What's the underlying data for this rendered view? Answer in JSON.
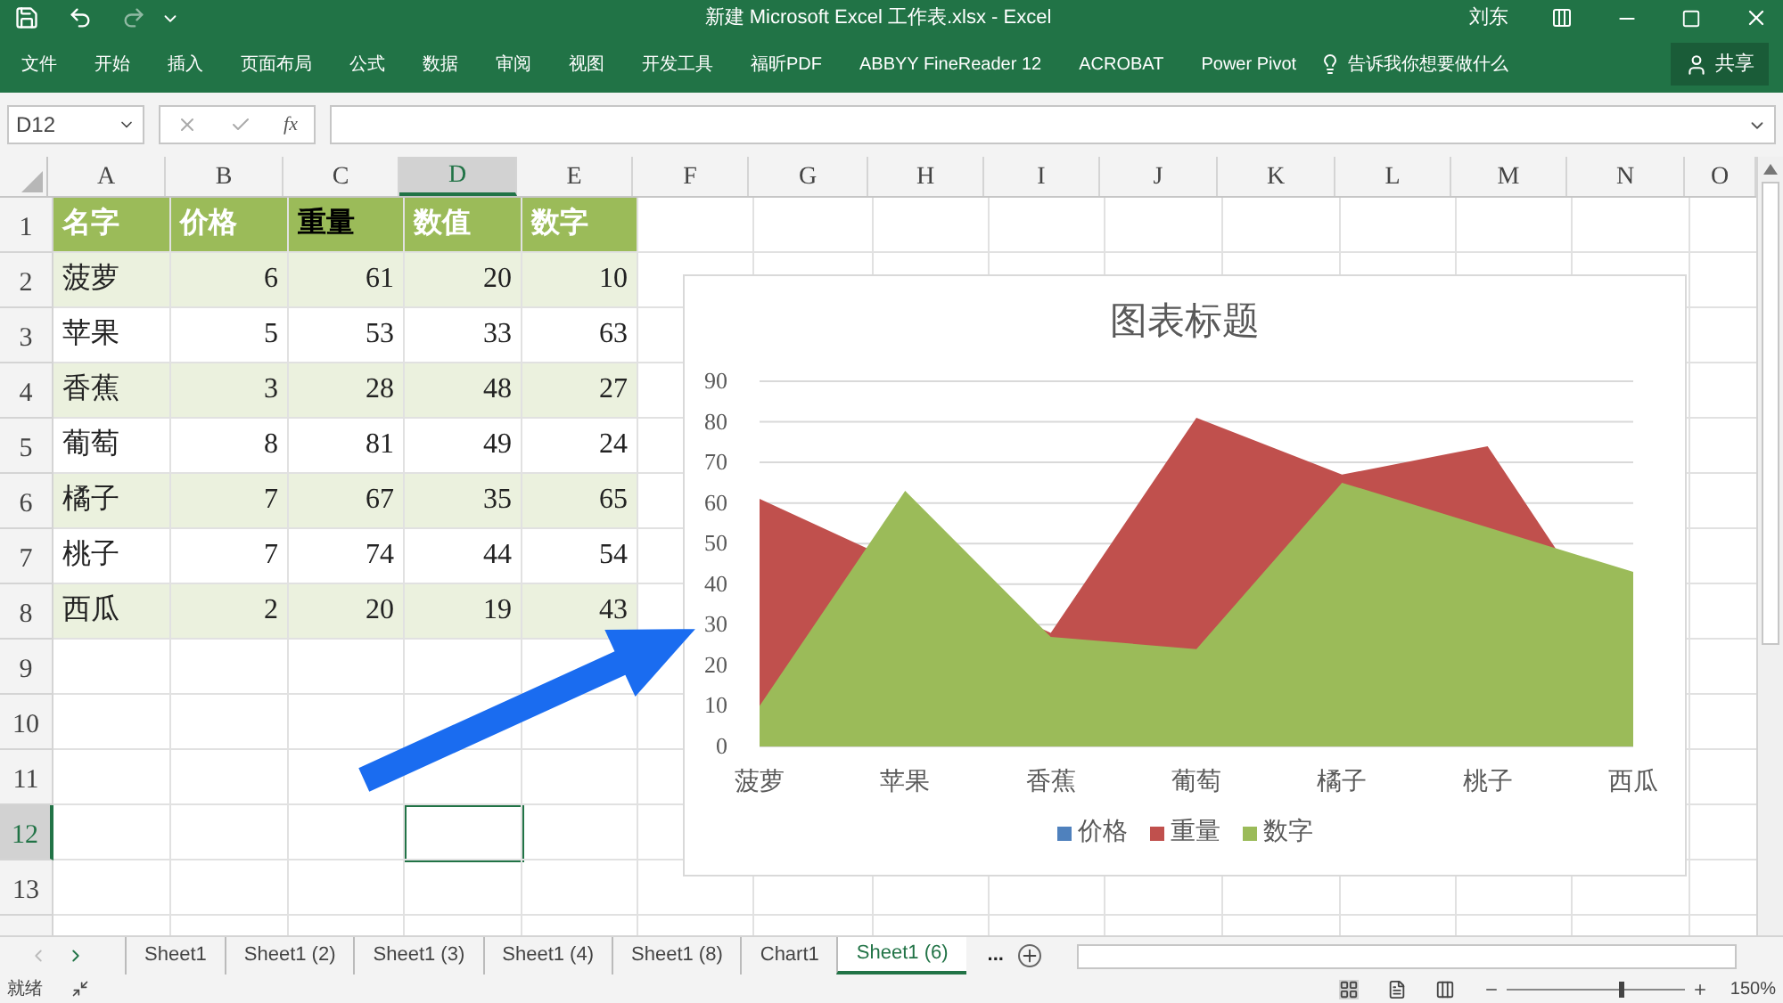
{
  "title_bar": {
    "title": "新建 Microsoft Excel 工作表.xlsx  -  Excel",
    "user": "刘东"
  },
  "ribbon_tabs": [
    "文件",
    "开始",
    "插入",
    "页面布局",
    "公式",
    "数据",
    "审阅",
    "视图",
    "开发工具",
    "福昕PDF",
    "ABBYY FineReader 12",
    "ACROBAT",
    "Power Pivot"
  ],
  "tell_me": "告诉我你想要做什么",
  "share_button": "共享",
  "name_box": "D12",
  "formula_fx": "fx",
  "columns": [
    {
      "label": "A",
      "selected": false
    },
    {
      "label": "B",
      "selected": false
    },
    {
      "label": "C",
      "selected": false
    },
    {
      "label": "D",
      "selected": true
    },
    {
      "label": "E",
      "selected": false
    },
    {
      "label": "F",
      "selected": false
    },
    {
      "label": "G",
      "selected": false
    },
    {
      "label": "H",
      "selected": false
    },
    {
      "label": "I",
      "selected": false
    },
    {
      "label": "J",
      "selected": false
    },
    {
      "label": "K",
      "selected": false
    },
    {
      "label": "L",
      "selected": false
    },
    {
      "label": "M",
      "selected": false
    },
    {
      "label": "N",
      "selected": false
    },
    {
      "label": "O",
      "selected": false
    }
  ],
  "rows": [
    {
      "number": "1",
      "selected": false,
      "kind": "header",
      "cells": [
        {
          "text": "名字",
          "dark": false
        },
        {
          "text": "价格",
          "dark": false
        },
        {
          "text": "重量",
          "dark": true
        },
        {
          "text": "数值",
          "dark": false
        },
        {
          "text": "数字",
          "dark": false
        }
      ]
    },
    {
      "number": "2",
      "selected": false,
      "kind": "banded",
      "cells": [
        "菠萝",
        "6",
        "61",
        "20",
        "10"
      ]
    },
    {
      "number": "3",
      "selected": false,
      "kind": "plain",
      "cells": [
        "苹果",
        "5",
        "53",
        "33",
        "63"
      ]
    },
    {
      "number": "4",
      "selected": false,
      "kind": "banded",
      "cells": [
        "香蕉",
        "3",
        "28",
        "48",
        "27"
      ]
    },
    {
      "number": "5",
      "selected": false,
      "kind": "plain",
      "cells": [
        "葡萄",
        "8",
        "81",
        "49",
        "24"
      ]
    },
    {
      "number": "6",
      "selected": false,
      "kind": "banded",
      "cells": [
        "橘子",
        "7",
        "67",
        "35",
        "65"
      ]
    },
    {
      "number": "7",
      "selected": false,
      "kind": "plain",
      "cells": [
        "桃子",
        "7",
        "74",
        "44",
        "54"
      ]
    },
    {
      "number": "8",
      "selected": false,
      "kind": "banded",
      "cells": [
        "西瓜",
        "2",
        "20",
        "19",
        "43"
      ]
    },
    {
      "number": "9",
      "selected": false,
      "kind": "empty"
    },
    {
      "number": "10",
      "selected": false,
      "kind": "empty"
    },
    {
      "number": "11",
      "selected": false,
      "kind": "empty"
    },
    {
      "number": "12",
      "selected": true,
      "kind": "empty"
    },
    {
      "number": "13",
      "selected": false,
      "kind": "empty"
    }
  ],
  "chart": {
    "chart_data": {
      "type": "area",
      "title": "图表标题",
      "categories": [
        "菠萝",
        "苹果",
        "香蕉",
        "葡萄",
        "橘子",
        "桃子",
        "西瓜"
      ],
      "series": [
        {
          "name": "价格",
          "color": "#4f81bd",
          "values": [
            null,
            null,
            null,
            null,
            null,
            null,
            null
          ]
        },
        {
          "name": "重量",
          "color": "#c0504d",
          "values": [
            61,
            null,
            28,
            81,
            67,
            74,
            20
          ]
        },
        {
          "name": "数字",
          "color": "#9bbb59",
          "values": [
            10,
            63,
            27,
            24,
            65,
            54,
            43
          ]
        }
      ],
      "grid": true,
      "legend": "bottom",
      "ylim": [
        0,
        90
      ],
      "yticks": [
        0,
        10,
        20,
        30,
        40,
        50,
        60,
        70,
        80,
        90
      ]
    }
  },
  "sheet_tabs": [
    {
      "label": "Sheet1",
      "selected": false
    },
    {
      "label": "Sheet1 (2)",
      "selected": false
    },
    {
      "label": "Sheet1 (3)",
      "selected": false
    },
    {
      "label": "Sheet1 (4)",
      "selected": false
    },
    {
      "label": "Sheet1 (8)",
      "selected": false
    },
    {
      "label": "Chart1",
      "selected": false
    },
    {
      "label": "Sheet1 (6)",
      "selected": true
    }
  ],
  "more_sheets": "...",
  "status_bar": {
    "status": "就绪",
    "zoom": {
      "level": 0.63,
      "reading": "150%"
    }
  }
}
